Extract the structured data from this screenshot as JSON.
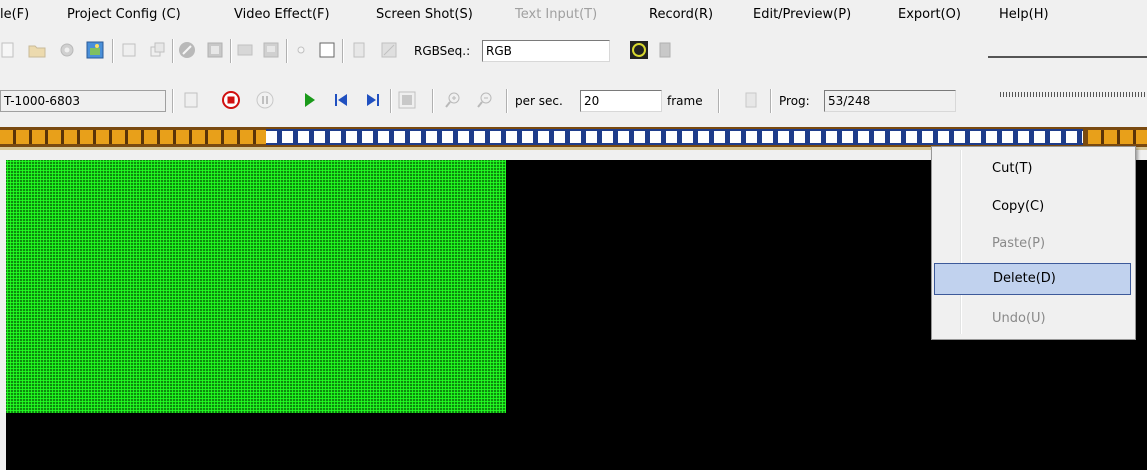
{
  "menubar": {
    "items": [
      {
        "label": "le(F)",
        "disabled": false
      },
      {
        "label": "Project Config (C)",
        "disabled": false
      },
      {
        "label": "Video Effect(F)",
        "disabled": false
      },
      {
        "label": "Screen Shot(S)",
        "disabled": false
      },
      {
        "label": "Text Input(T)",
        "disabled": true
      },
      {
        "label": "Record(R)",
        "disabled": false
      },
      {
        "label": "Edit/Preview(P)",
        "disabled": false
      },
      {
        "label": "Export(O)",
        "disabled": false
      },
      {
        "label": "Help(H)",
        "disabled": false
      }
    ]
  },
  "toolbar1": {
    "rgbseq_label": "RGBSeq.:",
    "rgbseq_value": "RGB"
  },
  "toolbar2": {
    "device_value": "T-1000-6803",
    "per_sec_label": "per sec.",
    "per_sec_value": "20",
    "frame_label": "frame",
    "prog_label": "Prog:",
    "prog_value": "53/248"
  },
  "context_menu": {
    "items": [
      {
        "label": "Cut(T)",
        "disabled": false,
        "selected": false
      },
      {
        "label": "Copy(C)",
        "disabled": false,
        "selected": false
      },
      {
        "label": "Paste(P)",
        "disabled": true,
        "selected": false
      },
      {
        "label": "Delete(D)",
        "disabled": false,
        "selected": true
      },
      {
        "label": "Undo(U)",
        "disabled": true,
        "selected": false
      }
    ]
  },
  "colors": {
    "led": "#22ff22",
    "preview_bg": "#000000",
    "film_highlight": "#1e3c8a",
    "menu_selected": "#c1d2ee"
  }
}
